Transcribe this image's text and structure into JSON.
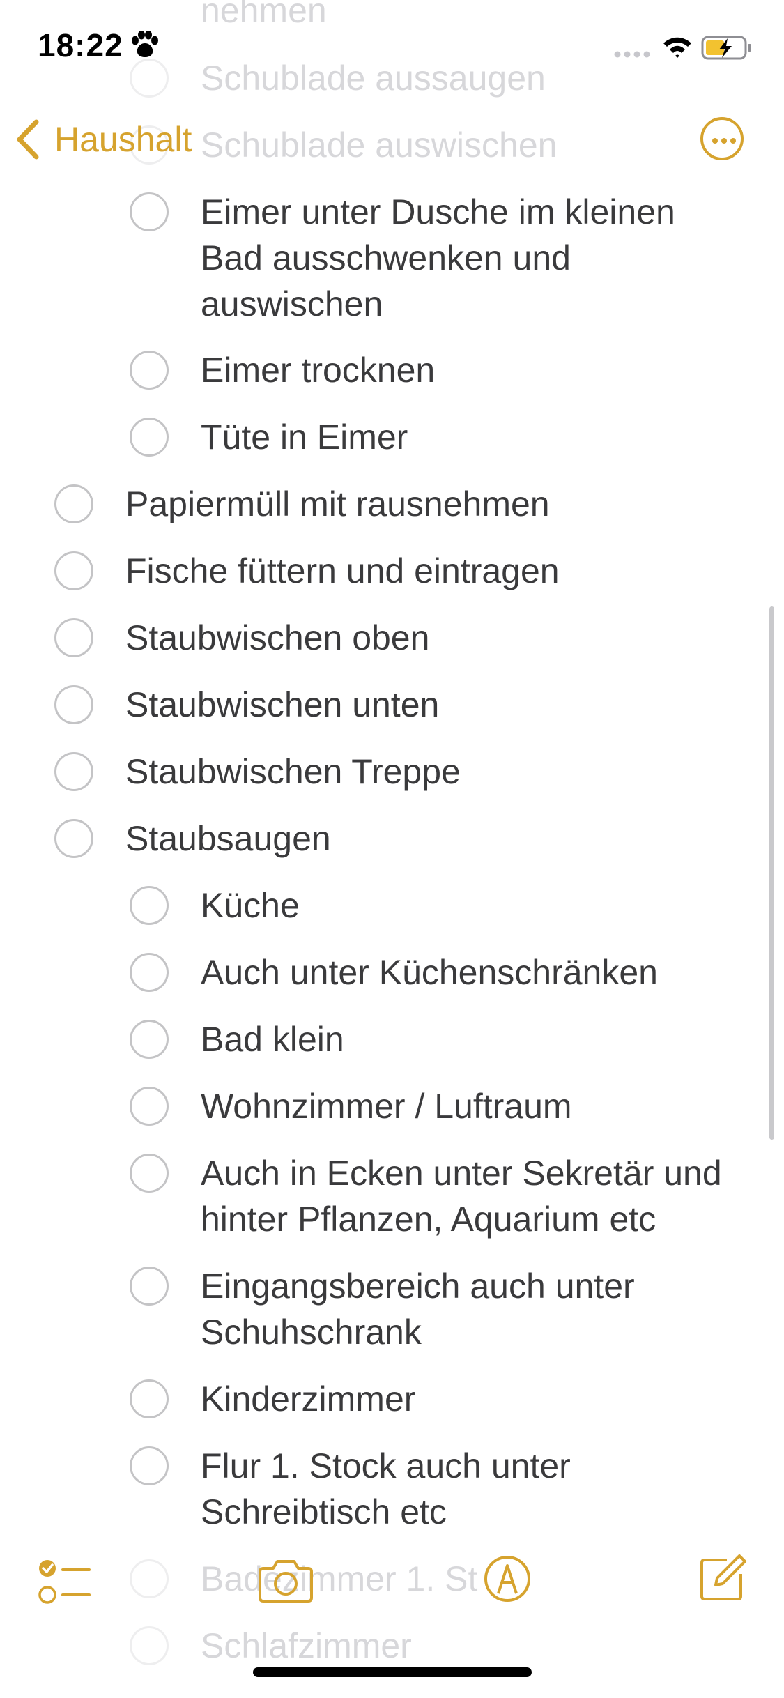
{
  "status_bar": {
    "time": "18:22"
  },
  "nav": {
    "back_label": "Haushalt"
  },
  "checklist": {
    "faded_top": [
      "nehmen",
      "Schublade aussaugen",
      "Schublade auswischen"
    ],
    "items": [
      {
        "lines": [
          "Eimer unter Dusche im kleinen",
          "Bad ausschwenken und",
          "auswischen"
        ]
      },
      {
        "lines": [
          "Eimer trocknen"
        ]
      },
      {
        "lines": [
          "Tüte in Eimer"
        ]
      },
      {
        "lines": [
          "Papiermüll mit rausnehmen"
        ]
      },
      {
        "lines": [
          "Fische füttern und eintragen"
        ]
      },
      {
        "lines": [
          "Staubwischen oben"
        ]
      },
      {
        "lines": [
          "Staubwischen unten"
        ]
      },
      {
        "lines": [
          "Staubwischen Treppe"
        ]
      },
      {
        "lines": [
          "Staubsaugen"
        ]
      },
      {
        "lines": [
          "Küche"
        ]
      },
      {
        "lines": [
          "Auch unter Küchenschränken"
        ]
      },
      {
        "lines": [
          "Bad klein"
        ]
      },
      {
        "lines": [
          "Wohnzimmer / Luftraum"
        ]
      },
      {
        "lines": [
          "Auch in Ecken unter Sekretär und",
          "hinter Pflanzen, Aquarium etc"
        ]
      },
      {
        "lines": [
          "Eingangsbereich auch unter",
          "Schuhschrank"
        ]
      },
      {
        "lines": [
          "Kinderzimmer"
        ]
      },
      {
        "lines": [
          "Flur 1. Stock auch unter",
          "Schreibtisch etc"
        ]
      }
    ],
    "faded_bottom": [
      "Badezimmer 1. St",
      "Schlafzimmer"
    ]
  },
  "colors": {
    "accent": "#d6a32e"
  }
}
